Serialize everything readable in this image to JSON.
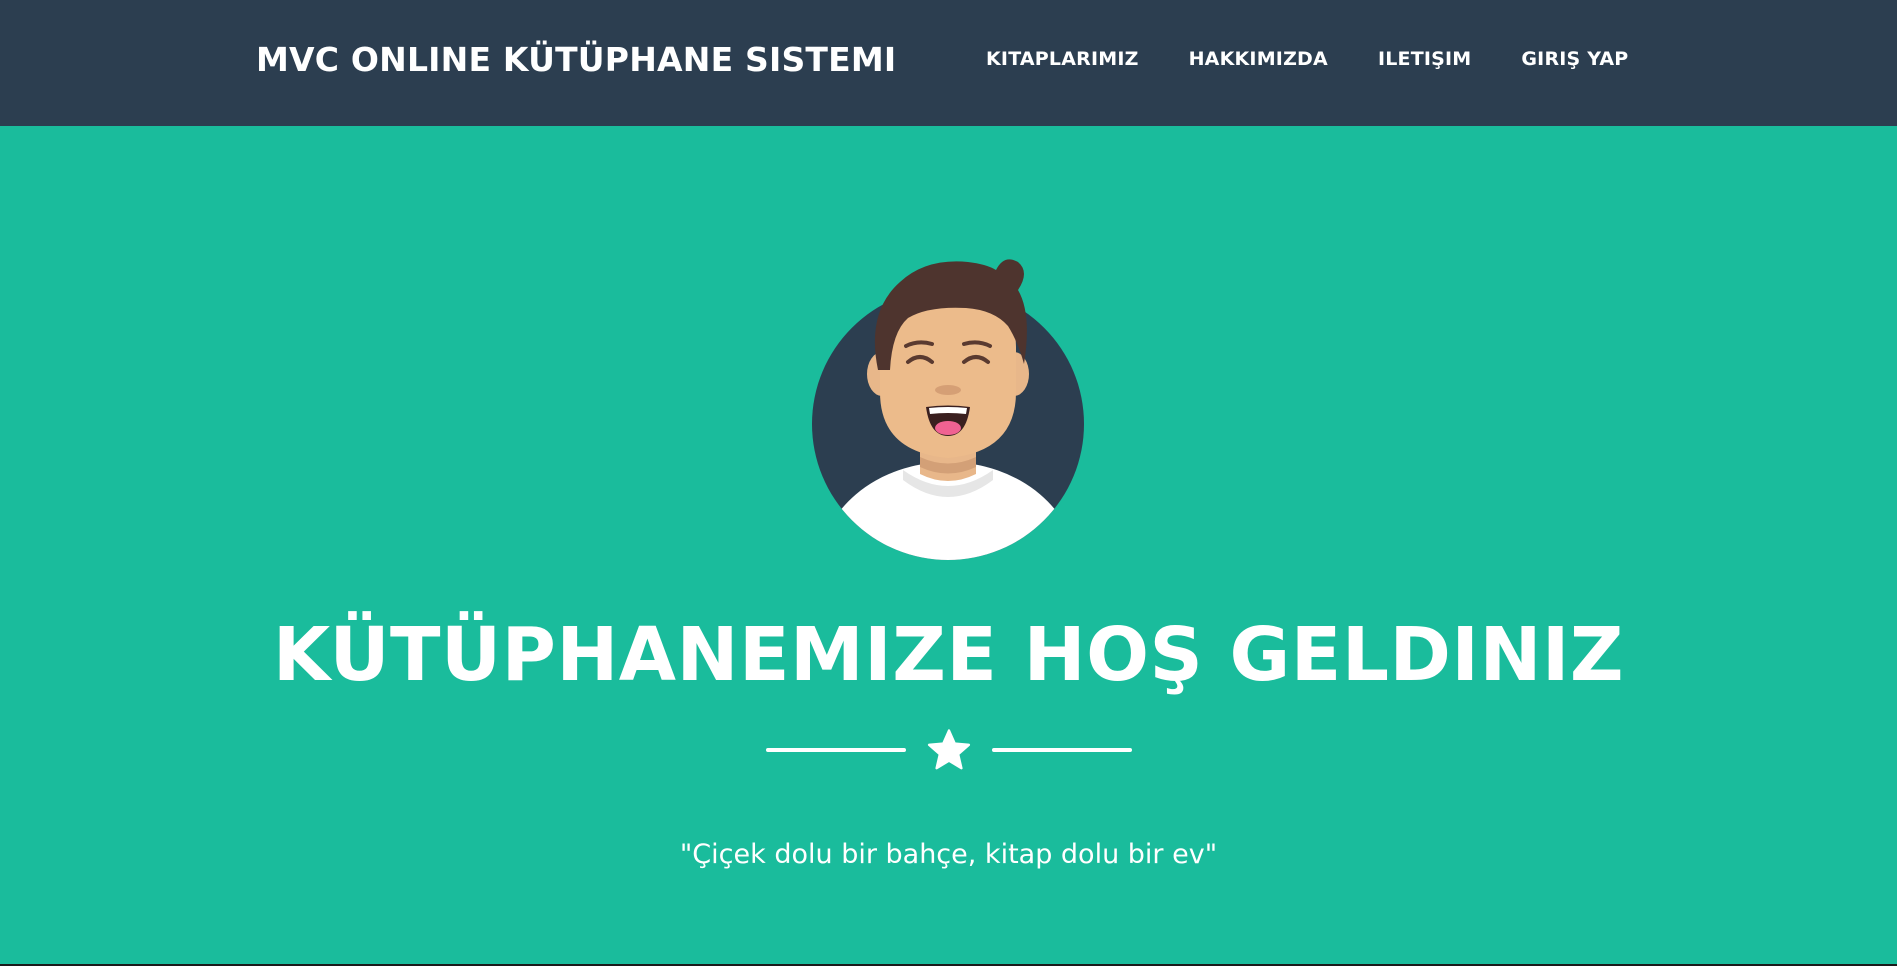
{
  "navbar": {
    "brand": "MVC ONLINE KÜTÜPHANE SISTEMI",
    "links": [
      {
        "label": "KITAPLARIMIZ"
      },
      {
        "label": "HAKKIMIZDA"
      },
      {
        "label": "ILETIŞIM"
      },
      {
        "label": "GIRIŞ YAP"
      }
    ]
  },
  "hero": {
    "title": "KÜTÜPHANEMIZE HOŞ GELDINIZ",
    "quote": "\"Çiçek dolu bir bahçe, kitap dolu bir ev\"",
    "divider_icon": "star-icon",
    "avatar_icon": "avatar-icon"
  },
  "colors": {
    "navbar_bg": "#2c3e50",
    "hero_bg": "#1abc9c",
    "text": "#ffffff"
  }
}
